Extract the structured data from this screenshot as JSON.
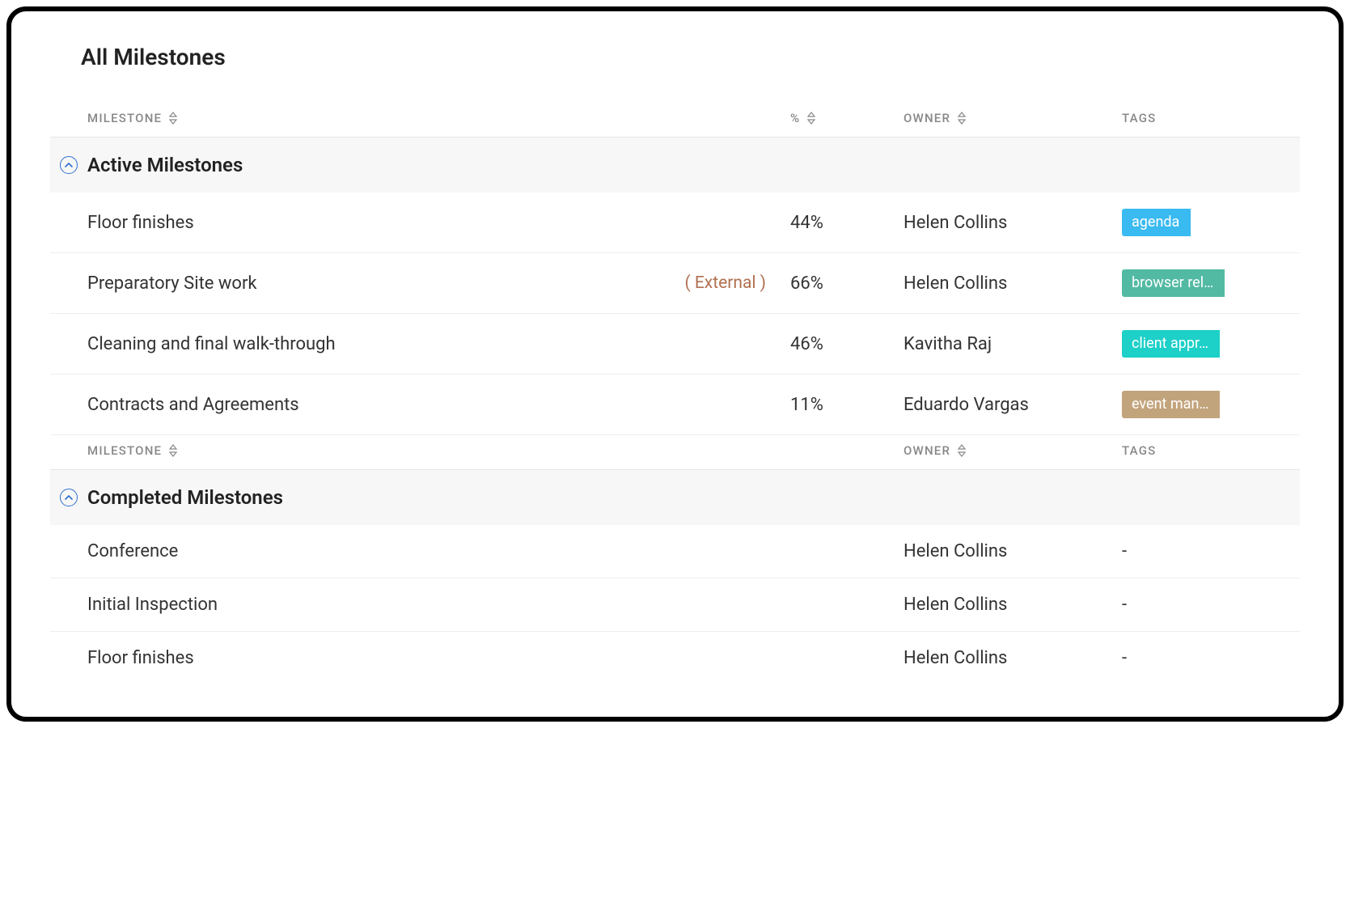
{
  "page_title": "All Milestones",
  "columns": {
    "milestone": "MILESTONE",
    "percent": "%",
    "owner": "OWNER",
    "tags": "TAGS"
  },
  "sections": {
    "active": {
      "title": "Active Milestones",
      "rows": [
        {
          "name": "Floor finishes",
          "external": "",
          "percent": "44%",
          "owner": "Helen Collins",
          "tag": "agenda",
          "tag_color": "agenda"
        },
        {
          "name": "Preparatory Site work",
          "external": "( External )",
          "percent": "66%",
          "owner": "Helen Collins",
          "tag": "browser rel…",
          "tag_color": "browser"
        },
        {
          "name": "Cleaning and final walk-through",
          "external": "",
          "percent": "46%",
          "owner": "Kavitha Raj",
          "tag": "client appr…",
          "tag_color": "client"
        },
        {
          "name": "Contracts and Agreements",
          "external": "",
          "percent": "11%",
          "owner": "Eduardo Vargas",
          "tag": "event man…",
          "tag_color": "event"
        }
      ]
    },
    "completed": {
      "title": "Completed Milestones",
      "rows": [
        {
          "name": "Conference",
          "owner": "Helen Collins",
          "tag_dash": "-"
        },
        {
          "name": "Initial Inspection",
          "owner": "Helen Collins",
          "tag_dash": "-"
        },
        {
          "name": "Floor finishes",
          "owner": "Helen Collins",
          "tag_dash": "-"
        }
      ]
    }
  }
}
